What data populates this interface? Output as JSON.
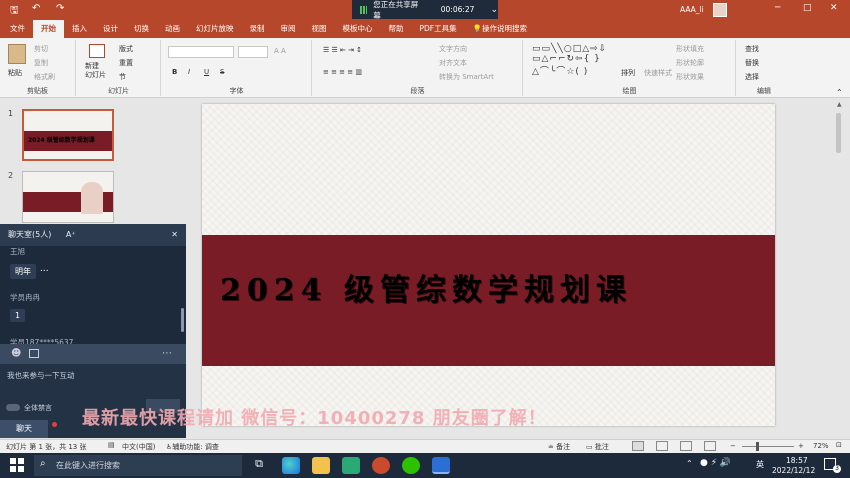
{
  "titlebar": {
    "qa_save": "🖫",
    "qa_undo": "↶",
    "qa_redo": "↷",
    "sharing_text": "您正在共享屏幕",
    "timer": "00:06:27",
    "user": "AAA_li",
    "win_min": "─",
    "win_max": "□",
    "win_close": "✕"
  },
  "tabs": [
    "文件",
    "开始",
    "插入",
    "设计",
    "切换",
    "动画",
    "幻灯片放映",
    "录制",
    "审阅",
    "视图",
    "模板中心",
    "帮助",
    "PDF工具集",
    "操作说明搜索"
  ],
  "ribbon": {
    "clipboard": {
      "paste": "粘贴",
      "cut": "剪切",
      "copy": "复制",
      "format_painter": "格式刷",
      "label": "剪贴板"
    },
    "slides": {
      "new_slide": "新建\n幻灯片",
      "layout": "版式",
      "reset": "重置",
      "section": "节",
      "label": "幻灯片"
    },
    "font": {
      "bold": "B",
      "italic": "I",
      "underline": "U",
      "strike": "S",
      "label": "字体"
    },
    "paragraph": {
      "text_direction": "文字方向",
      "align_text": "对齐文本",
      "convert_smartart": "转换为 SmartArt",
      "label": "段落"
    },
    "drawing": {
      "arrange": "排列",
      "quick_styles": "快速样式",
      "shape_fill": "形状填充",
      "shape_outline": "形状轮廓",
      "shape_effects": "形状效果",
      "label": "绘图"
    },
    "editing": {
      "find": "查找",
      "replace": "替换",
      "select": "选择",
      "label": "编辑"
    }
  },
  "thumbs": [
    {
      "num": "1",
      "text": "2024 级管综数学规划课"
    },
    {
      "num": "2",
      "text": ""
    }
  ],
  "slide": {
    "title": "2024 级管综数学规划课",
    "band_color": "#7a1c26"
  },
  "chat": {
    "title": "聊天室(5人)",
    "font_toggle": "A⁺",
    "close": "✕",
    "sender1": "王旭",
    "msg1": "明年",
    "more": "...",
    "sender2": "学员冉冉",
    "msg2": "1",
    "sender3": "学员187****5637",
    "msg3": "我也来参与一下互动",
    "mute_all": "全体禁言",
    "tab": "聊天"
  },
  "watermark": "最新最快课程请加 微信号：10400278 朋友圈了解！",
  "status": {
    "slide_info": "幻灯片 第 1 张，共 13 张",
    "lang": "中文(中国)",
    "accessibility": "辅助功能: 调查",
    "notes": "备注",
    "comments": "批注",
    "zoom": "72%"
  },
  "taskbar": {
    "search_placeholder": "在此键入进行搜索",
    "ime": "英",
    "time": "18:57",
    "date": "2022/12/12",
    "notify": "3"
  }
}
